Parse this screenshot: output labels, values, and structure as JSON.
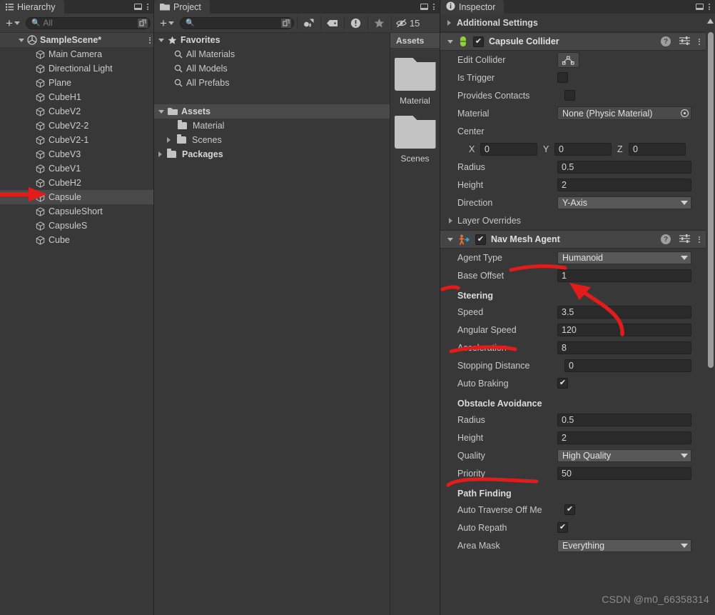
{
  "hierarchy": {
    "tab_label": "Hierarchy",
    "tab_icon": "hierarchy-icon",
    "search_placeholder": "All",
    "scene_name": "SampleScene*",
    "items": [
      {
        "label": "Main Camera"
      },
      {
        "label": "Directional Light"
      },
      {
        "label": "Plane"
      },
      {
        "label": "CubeH1"
      },
      {
        "label": "CubeV2"
      },
      {
        "label": "CubeV2-2"
      },
      {
        "label": "CubeV2-1"
      },
      {
        "label": "CubeV3"
      },
      {
        "label": "CubeV1"
      },
      {
        "label": "CubeH2"
      },
      {
        "label": "Capsule"
      },
      {
        "label": "CapsuleShort"
      },
      {
        "label": "CapsuleS"
      },
      {
        "label": "Cube"
      }
    ],
    "selected_index": 10
  },
  "project": {
    "tab_label": "Project",
    "search_value": "",
    "hidden_count": "15",
    "favorites_label": "Favorites",
    "favorites": [
      {
        "label": "All Materials"
      },
      {
        "label": "All Models"
      },
      {
        "label": "All Prefabs"
      }
    ],
    "assets_label": "Assets",
    "assets_children": [
      {
        "label": "Material",
        "expandable": false
      },
      {
        "label": "Scenes",
        "expandable": true
      }
    ],
    "packages_label": "Packages",
    "grid_header": "Assets",
    "grid_items": [
      {
        "label": "Material"
      },
      {
        "label": "Scenes"
      }
    ]
  },
  "inspector": {
    "tab_label": "Inspector",
    "additional_settings_label": "Additional Settings",
    "components": [
      {
        "name": "Capsule Collider",
        "enabled": true,
        "icon_color": "#8ed13b",
        "rows": [
          {
            "type": "button",
            "label": "Edit Collider",
            "button_label": "edit-collider-icon"
          },
          {
            "type": "checkbox",
            "label": "Is Trigger",
            "value": false
          },
          {
            "type": "checkbox",
            "label": "Provides Contacts",
            "value": false
          },
          {
            "type": "object",
            "label": "Material",
            "value": "None (Physic Material)"
          },
          {
            "type": "header",
            "label": "Center"
          },
          {
            "type": "vector3",
            "label": "",
            "x": "0",
            "y": "0",
            "z": "0"
          },
          {
            "type": "field",
            "label": "Radius",
            "value": "0.5"
          },
          {
            "type": "field",
            "label": "Height",
            "value": "2"
          },
          {
            "type": "dropdown",
            "label": "Direction",
            "value": "Y-Axis"
          },
          {
            "type": "foldout",
            "label": "Layer Overrides"
          }
        ]
      },
      {
        "name": "Nav Mesh Agent",
        "enabled": true,
        "icon_color": "#e8743b",
        "rows": [
          {
            "type": "dropdown",
            "label": "Agent Type",
            "value": "Humanoid"
          },
          {
            "type": "field",
            "label": "Base Offset",
            "value": "1"
          },
          {
            "type": "section",
            "label": "Steering"
          },
          {
            "type": "field",
            "label": "Speed",
            "value": "3.5"
          },
          {
            "type": "field",
            "label": "Angular Speed",
            "value": "120"
          },
          {
            "type": "field",
            "label": "Acceleration",
            "value": "8"
          },
          {
            "type": "field",
            "label": "Stopping Distance",
            "value": "0"
          },
          {
            "type": "checkbox",
            "label": "Auto Braking",
            "value": true
          },
          {
            "type": "section",
            "label": "Obstacle Avoidance"
          },
          {
            "type": "field",
            "label": "Radius",
            "value": "0.5"
          },
          {
            "type": "field",
            "label": "Height",
            "value": "2"
          },
          {
            "type": "dropdown",
            "label": "Quality",
            "value": "High Quality"
          },
          {
            "type": "field",
            "label": "Priority",
            "value": "50"
          },
          {
            "type": "section",
            "label": "Path Finding"
          },
          {
            "type": "checkbox",
            "label": "Auto Traverse Off Me",
            "value": true
          },
          {
            "type": "checkbox",
            "label": "Auto Repath",
            "value": true
          },
          {
            "type": "dropdown",
            "label": "Area Mask",
            "value": "Everything"
          }
        ]
      }
    ]
  },
  "watermark": "CSDN @m0_66358314",
  "accent": {
    "annotation": "#e21b1b",
    "selection": "#4a4a4a"
  }
}
